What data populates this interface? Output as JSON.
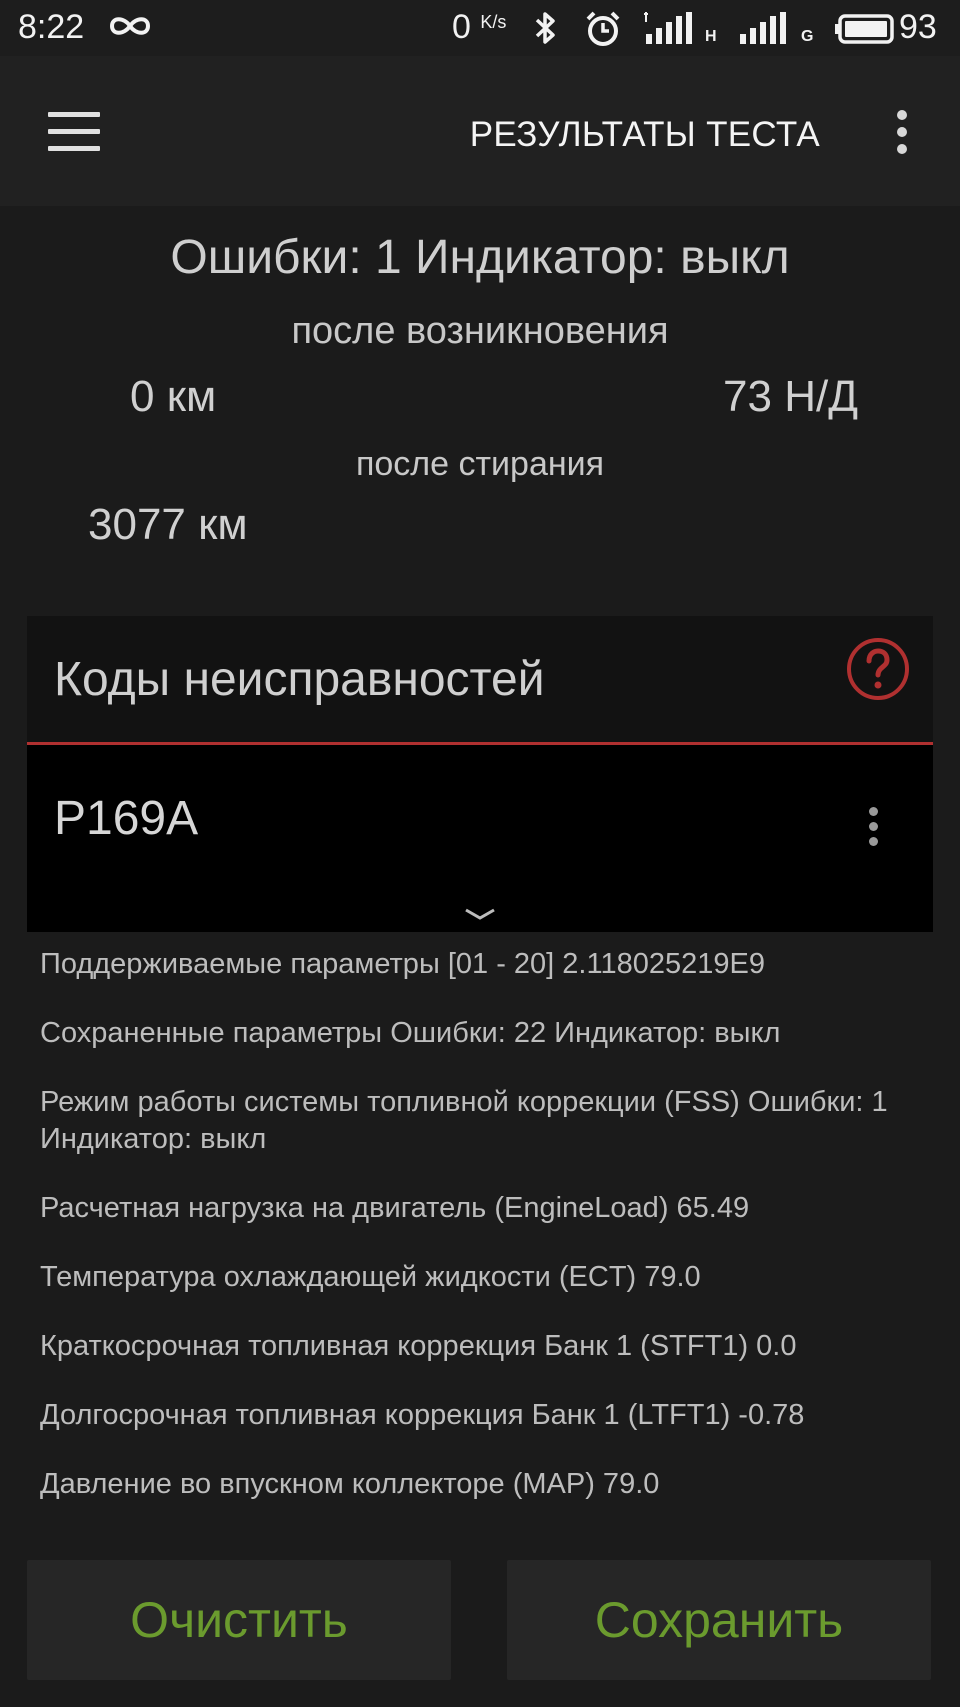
{
  "status_bar": {
    "time": "8:22",
    "net_speed": "0",
    "net_speed_unit": "K/s",
    "sim1_label": "H",
    "sim2_label": "G",
    "battery": "93",
    "icons": [
      "infinity-icon",
      "bluetooth-icon",
      "alarm-icon",
      "signal-icon",
      "signal-icon",
      "battery-icon"
    ]
  },
  "app_bar": {
    "title": "РЕЗУЛЬТАТЫ ТЕСТА",
    "icons": [
      "menu-icon",
      "more-vert-icon"
    ]
  },
  "summary": {
    "title": "Ошибки: 1 Индикатор: выкл",
    "after_occurrence_label": "после возникновения",
    "after_occurrence_km": "0 км",
    "after_occurrence_nd": "73 Н/Д",
    "after_clear_label": "после стирания",
    "after_clear_km": "3077 км"
  },
  "codes": {
    "title": "Коды неисправностей",
    "accent_color": "#b03030",
    "items": [
      {
        "code": "P169A"
      }
    ]
  },
  "params": [
    "Поддерживаемые параметры [01 - 20] 2.118025219E9",
    "Сохраненные параметры Ошибки: 22 Индикатор: выкл",
    "Режим работы системы топливной коррекции (FSS) Ошибки: 1 Индикатор: выкл",
    "Расчетная нагрузка на двигатель (EngineLoad) 65.49",
    "Температура охлаждающей жидкости (ECT) 79.0",
    "Краткосрочная топливная коррекция Банк 1 (STFT1) 0.0",
    "Долгосрочная топливная коррекция Банк 1 (LTFT1) -0.78",
    "Давление во впускном коллекторе (MAP) 79.0"
  ],
  "buttons": {
    "clear": "Очистить",
    "save": "Сохранить",
    "text_color": "#6b9b2e"
  }
}
